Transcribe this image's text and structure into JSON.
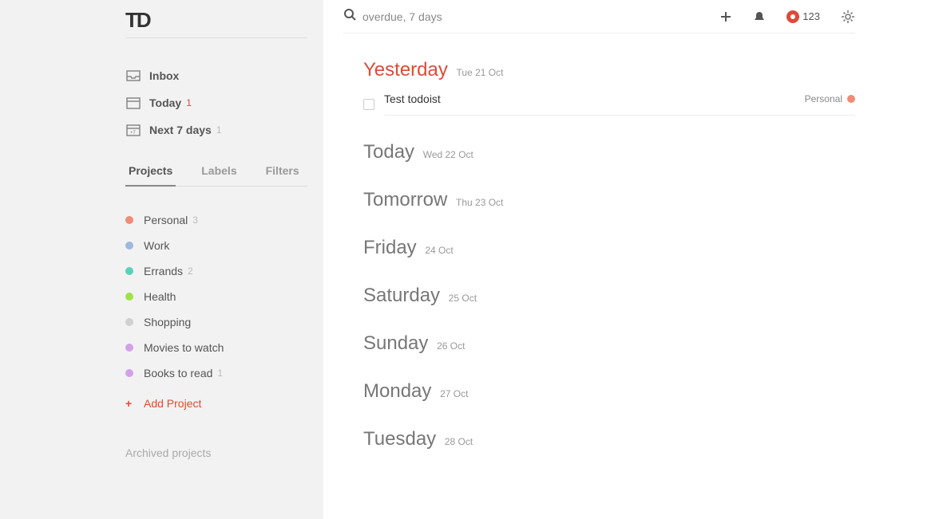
{
  "sidebar": {
    "logo": "TD",
    "nav": {
      "inbox": {
        "label": "Inbox"
      },
      "today": {
        "label": "Today",
        "count": "1"
      },
      "next7": {
        "label": "Next 7 days",
        "count": "1"
      }
    },
    "tabs": {
      "projects": "Projects",
      "labels": "Labels",
      "filters": "Filters"
    },
    "projects": [
      {
        "name": "Personal",
        "count": "3",
        "color": "#ef8b76"
      },
      {
        "name": "Work",
        "count": "",
        "color": "#9fb8dd"
      },
      {
        "name": "Errands",
        "count": "2",
        "color": "#5ad1bb"
      },
      {
        "name": "Health",
        "count": "",
        "color": "#a0e24a"
      },
      {
        "name": "Shopping",
        "count": "",
        "color": "#d0d0d0"
      },
      {
        "name": "Movies to watch",
        "count": "",
        "color": "#d3a0e8"
      },
      {
        "name": "Books to read",
        "count": "1",
        "color": "#d3a0e8"
      }
    ],
    "add_project": "Add Project",
    "archived": "Archived projects"
  },
  "topbar": {
    "search_value": "overdue, 7 days",
    "karma": "123"
  },
  "days": [
    {
      "title": "Yesterday",
      "sub": "Tue 21 Oct",
      "overdue": true,
      "tasks": [
        {
          "text": "Test todoist",
          "project": "Personal",
          "color": "#ef8b76"
        }
      ]
    },
    {
      "title": "Today",
      "sub": "Wed 22 Oct"
    },
    {
      "title": "Tomorrow",
      "sub": "Thu 23 Oct"
    },
    {
      "title": "Friday",
      "sub": "24 Oct"
    },
    {
      "title": "Saturday",
      "sub": "25 Oct"
    },
    {
      "title": "Sunday",
      "sub": "26 Oct"
    },
    {
      "title": "Monday",
      "sub": "27 Oct"
    },
    {
      "title": "Tuesday",
      "sub": "28 Oct"
    }
  ]
}
